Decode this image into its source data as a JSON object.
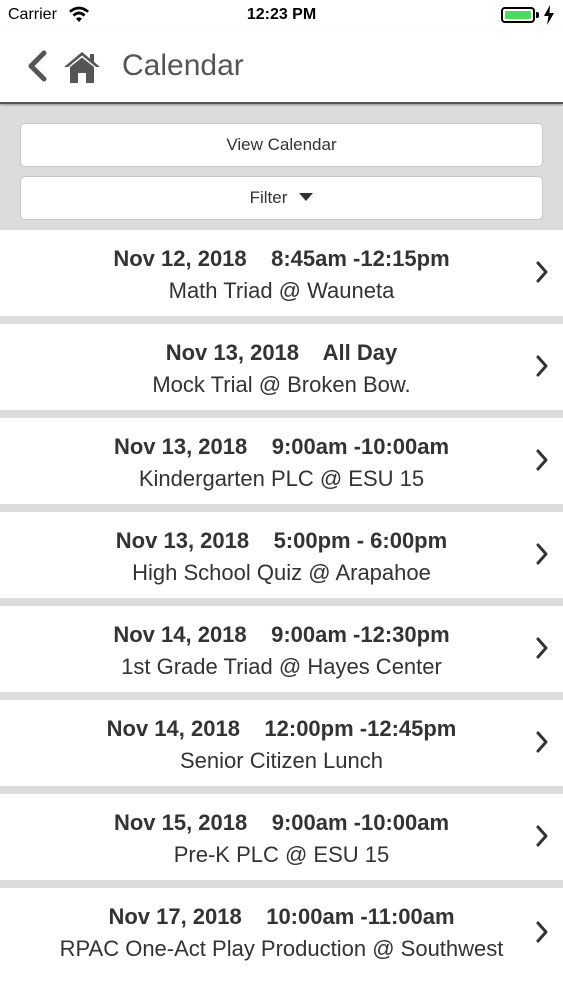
{
  "status_bar": {
    "carrier": "Carrier",
    "time": "12:23 PM",
    "battery_level": 1.0,
    "icons": [
      "wifi-icon",
      "battery-icon",
      "charging-bolt-icon"
    ]
  },
  "nav": {
    "title": "Calendar",
    "back_icon": "chevron-left-icon",
    "home_icon": "home-icon"
  },
  "controls": {
    "view_calendar_label": "View Calendar",
    "filter_label": "Filter"
  },
  "events": [
    {
      "date": "Nov 12, 2018",
      "time": "8:45am -12:15pm",
      "title": "Math Triad @ Wauneta"
    },
    {
      "date": "Nov 13, 2018",
      "time": "All Day",
      "title": "Mock Trial @ Broken Bow."
    },
    {
      "date": "Nov 13, 2018",
      "time": "9:00am -10:00am",
      "title": "Kindergarten PLC @ ESU 15"
    },
    {
      "date": "Nov 13, 2018",
      "time": "5:00pm - 6:00pm",
      "title": "High School Quiz @ Arapahoe"
    },
    {
      "date": "Nov 14, 2018",
      "time": "9:00am -12:30pm",
      "title": "1st Grade Triad @ Hayes Center"
    },
    {
      "date": "Nov 14, 2018",
      "time": "12:00pm -12:45pm",
      "title": "Senior Citizen Lunch"
    },
    {
      "date": "Nov 15, 2018",
      "time": "9:00am -10:00am",
      "title": "Pre-K PLC @ ESU 15"
    },
    {
      "date": "Nov 17, 2018",
      "time": "10:00am -11:00am",
      "title": "RPAC One-Act Play Production @ Southwest"
    }
  ],
  "colors": {
    "battery": "#4cd964",
    "background": "#dcdcdc",
    "text": "#333333"
  }
}
